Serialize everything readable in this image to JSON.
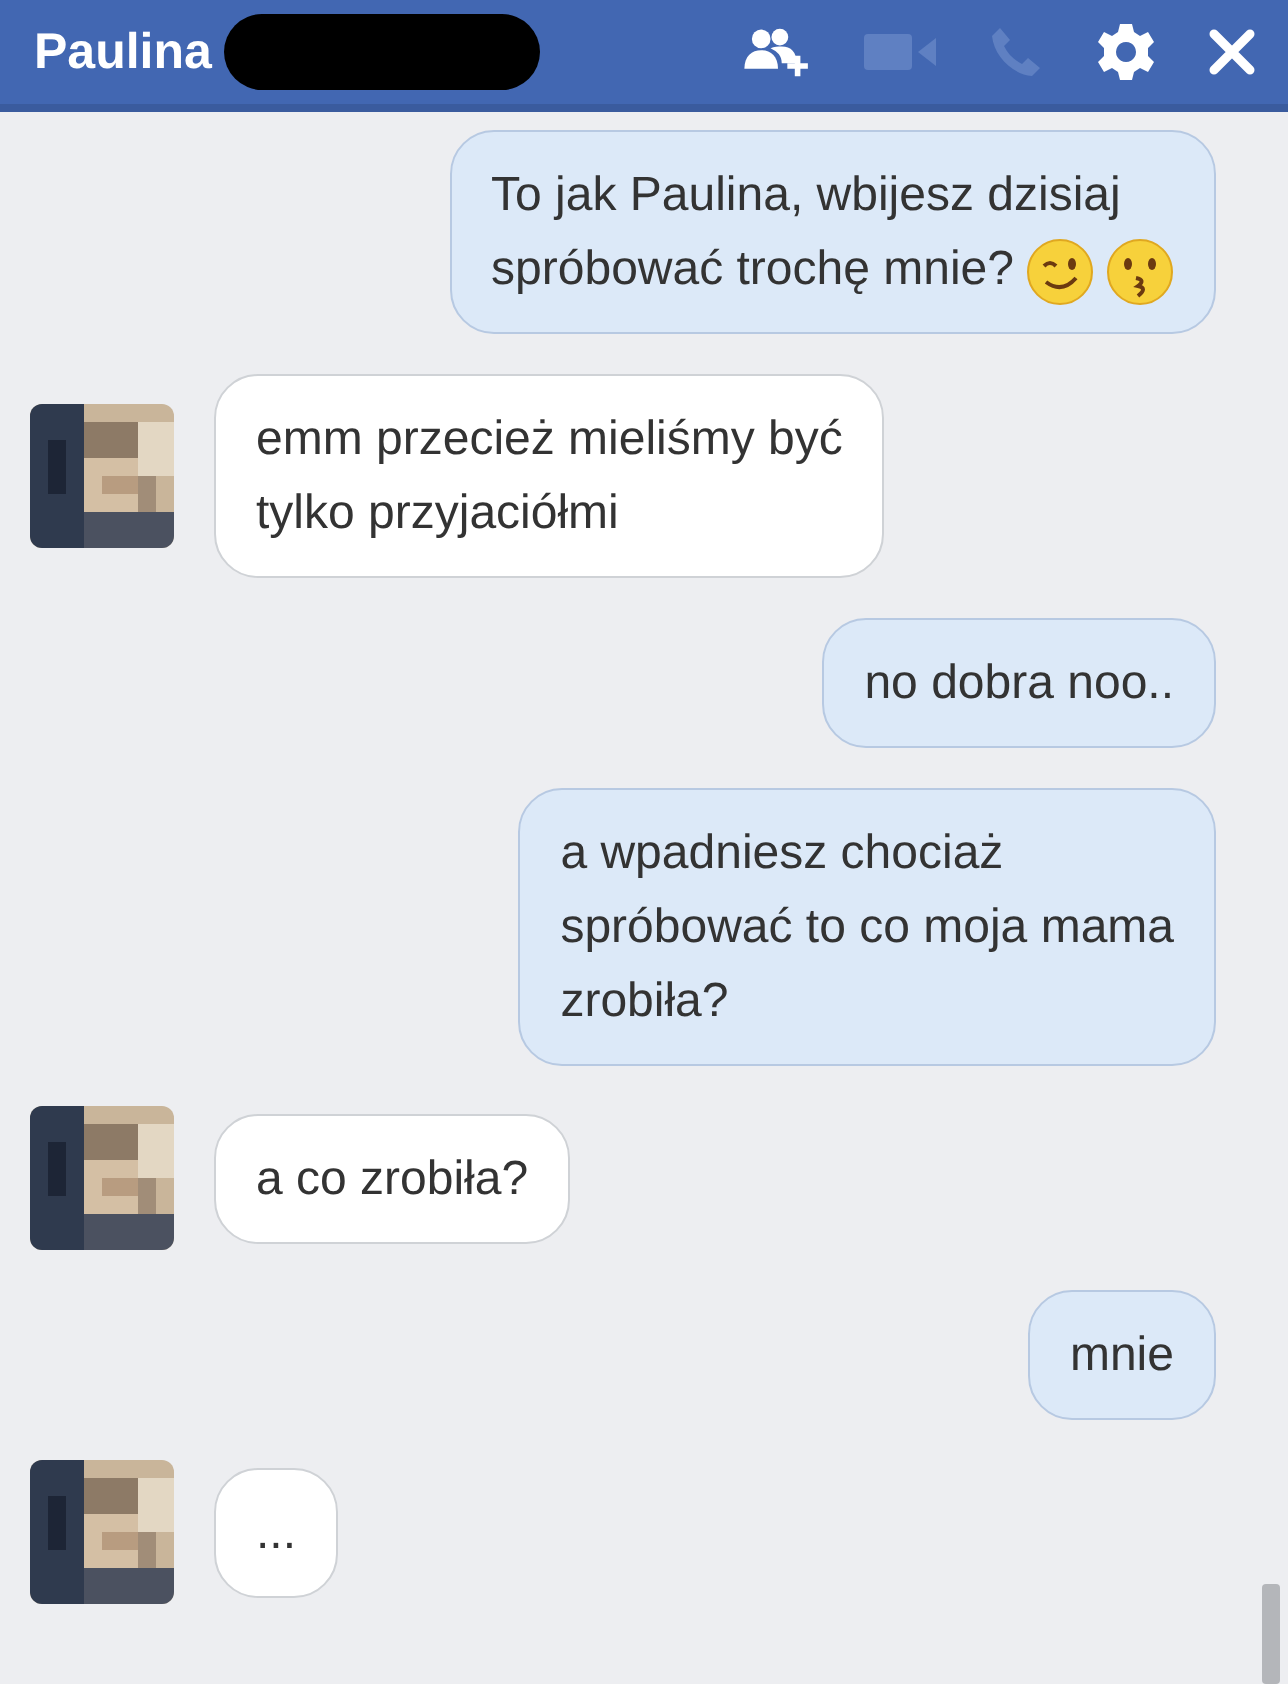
{
  "header": {
    "title": "Paulina",
    "buttons": [
      {
        "kind": "add-person",
        "disabled": false
      },
      {
        "kind": "video",
        "disabled": true
      },
      {
        "kind": "phone",
        "disabled": true
      },
      {
        "kind": "settings",
        "disabled": false
      },
      {
        "kind": "close",
        "disabled": false
      }
    ]
  },
  "messages": [
    {
      "outgoing": true,
      "text": "To jak Paulina, wbijesz dzisiaj\nspróbować trochę mnie?",
      "emojis": [
        {
          "kind": "wink"
        },
        {
          "kind": "kiss"
        }
      ]
    },
    {
      "outgoing": false,
      "text": "emm przecież mieliśmy być\ntylko przyjaciółmi"
    },
    {
      "outgoing": true,
      "text": "no dobra noo.."
    },
    {
      "outgoing": true,
      "text": "a wpadniesz chociaż\nspróbować to co moja mama\nzrobiła?"
    },
    {
      "outgoing": false,
      "text": "a co zrobiła?"
    },
    {
      "outgoing": true,
      "text": "mnie"
    },
    {
      "outgoing": false,
      "text": "..."
    }
  ]
}
